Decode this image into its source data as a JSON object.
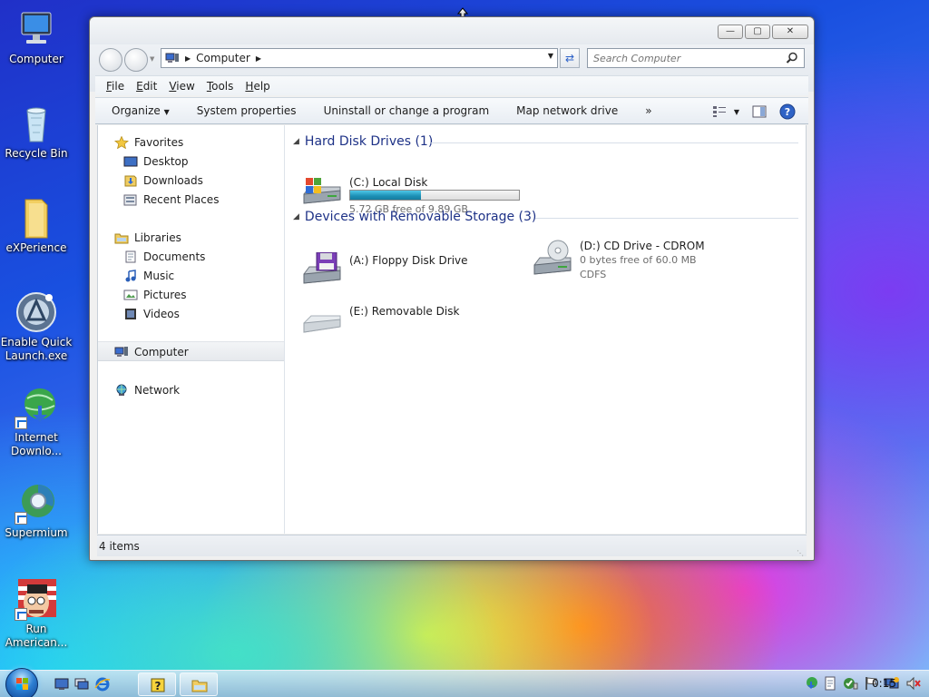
{
  "desktop": {
    "icons": [
      {
        "label": "Computer"
      },
      {
        "label": "Recycle Bin"
      },
      {
        "label": "eXPerience"
      },
      {
        "label": "Enable Quick Launch.exe"
      },
      {
        "label": "Internet Downlo..."
      },
      {
        "label": "Supermium"
      },
      {
        "label": "Run American..."
      }
    ]
  },
  "window": {
    "address": {
      "crumb": "Computer"
    },
    "search": {
      "placeholder": "Search Computer"
    },
    "menu": {
      "file": "File",
      "edit": "Edit",
      "view": "View",
      "tools": "Tools",
      "help": "Help"
    },
    "commands": {
      "organize": "Organize",
      "system_properties": "System properties",
      "uninstall": "Uninstall or change a program",
      "map_drive": "Map network drive",
      "more": "»"
    },
    "nav": {
      "favorites": "Favorites",
      "desktop": "Desktop",
      "downloads": "Downloads",
      "recent": "Recent Places",
      "libraries": "Libraries",
      "documents": "Documents",
      "music": "Music",
      "pictures": "Pictures",
      "videos": "Videos",
      "computer": "Computer",
      "network": "Network"
    },
    "groups": {
      "hard_disks": "Hard Disk Drives (1)",
      "removable": "Devices with Removable Storage (3)"
    },
    "drives": {
      "c": {
        "name": "(C:) Local Disk",
        "free": "5.72 GB free of 9.89 GB",
        "used_fraction": 0.42
      },
      "a": {
        "name": "(A:) Floppy Disk Drive"
      },
      "d": {
        "name": "(D:) CD Drive - CDROM",
        "free": "0 bytes free of 60.0 MB",
        "fs": "CDFS"
      },
      "e": {
        "name": "(E:) Removable Disk"
      }
    },
    "status": {
      "items": "4 items"
    }
  },
  "taskbar": {
    "clock": "0:15"
  }
}
